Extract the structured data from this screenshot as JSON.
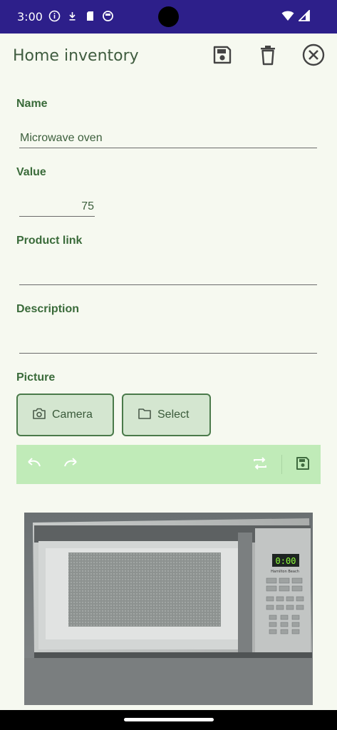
{
  "status_bar": {
    "time": "3:00",
    "left_icons": [
      "info-icon",
      "download-icon",
      "sd-card-icon",
      "circle-icon"
    ],
    "right_icons": [
      "wifi-icon",
      "signal-icon"
    ],
    "background": "#2d1f8a"
  },
  "app_bar": {
    "title": "Home inventory",
    "actions": [
      "save-icon",
      "delete-icon",
      "close-icon"
    ]
  },
  "form": {
    "name": {
      "label": "Name",
      "value": "Microwave oven"
    },
    "value": {
      "label": "Value",
      "value": "75"
    },
    "product_link": {
      "label": "Product link",
      "value": ""
    },
    "description": {
      "label": "Description",
      "value": ""
    },
    "picture": {
      "label": "Picture",
      "camera_label": "Camera",
      "select_label": "Select"
    }
  },
  "editor_toolbar": {
    "actions": [
      "undo-icon",
      "redo-icon",
      "rotate-icon",
      "save-icon"
    ],
    "background": "#c0ebb8"
  },
  "photo": {
    "microwave_display": "0:00",
    "brand": "Hamilton Beach"
  },
  "colors": {
    "background": "#f6f9f0",
    "label": "#3a6b3a",
    "accent_button_fill": "#d4e6d0"
  }
}
